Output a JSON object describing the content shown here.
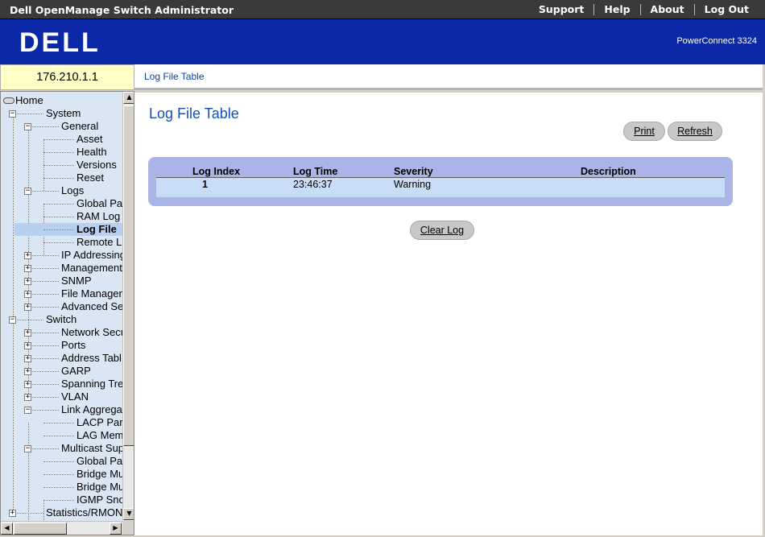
{
  "topbar": {
    "title": "Dell OpenManage Switch Administrator",
    "links": [
      "Support",
      "Help",
      "About",
      "Log Out"
    ]
  },
  "banner": {
    "logo_text": "DELL",
    "model": "PowerConnect 3324"
  },
  "ip_address": "176.210.1.1",
  "breadcrumb": "Log File Table",
  "tree": [
    {
      "label": "Home",
      "level": 0,
      "toggle": "",
      "selected": false
    },
    {
      "label": "System",
      "level": 1,
      "toggle": "-",
      "selected": false
    },
    {
      "label": "General",
      "level": 2,
      "toggle": "-",
      "selected": false
    },
    {
      "label": "Asset",
      "level": 3,
      "toggle": "",
      "selected": false
    },
    {
      "label": "Health",
      "level": 3,
      "toggle": "",
      "selected": false
    },
    {
      "label": "Versions",
      "level": 3,
      "toggle": "",
      "selected": false
    },
    {
      "label": "Reset",
      "level": 3,
      "toggle": "",
      "selected": false
    },
    {
      "label": "Logs",
      "level": 2,
      "toggle": "-",
      "selected": false
    },
    {
      "label": "Global Pa",
      "level": 3,
      "toggle": "",
      "selected": false
    },
    {
      "label": "RAM Log",
      "level": 3,
      "toggle": "",
      "selected": false
    },
    {
      "label": "Log File",
      "level": 3,
      "toggle": "",
      "selected": true
    },
    {
      "label": "Remote Lo",
      "level": 3,
      "toggle": "",
      "selected": false
    },
    {
      "label": "IP Addressing",
      "level": 2,
      "toggle": "+",
      "selected": false
    },
    {
      "label": "Management",
      "level": 2,
      "toggle": "+",
      "selected": false
    },
    {
      "label": "SNMP",
      "level": 2,
      "toggle": "+",
      "selected": false
    },
    {
      "label": "File Managen",
      "level": 2,
      "toggle": "+",
      "selected": false
    },
    {
      "label": "Advanced Se",
      "level": 2,
      "toggle": "+",
      "selected": false
    },
    {
      "label": "Switch",
      "level": 1,
      "toggle": "-",
      "selected": false
    },
    {
      "label": "Network Secu",
      "level": 2,
      "toggle": "+",
      "selected": false
    },
    {
      "label": "Ports",
      "level": 2,
      "toggle": "+",
      "selected": false
    },
    {
      "label": "Address Tabl",
      "level": 2,
      "toggle": "+",
      "selected": false
    },
    {
      "label": "GARP",
      "level": 2,
      "toggle": "+",
      "selected": false
    },
    {
      "label": "Spanning Tre",
      "level": 2,
      "toggle": "+",
      "selected": false
    },
    {
      "label": "VLAN",
      "level": 2,
      "toggle": "+",
      "selected": false
    },
    {
      "label": "Link Aggrega",
      "level": 2,
      "toggle": "-",
      "selected": false
    },
    {
      "label": "LACP Par",
      "level": 3,
      "toggle": "",
      "selected": false
    },
    {
      "label": "LAG Mem",
      "level": 3,
      "toggle": "",
      "selected": false
    },
    {
      "label": "Multicast Sup",
      "level": 2,
      "toggle": "-",
      "selected": false
    },
    {
      "label": "Global Pa",
      "level": 3,
      "toggle": "",
      "selected": false
    },
    {
      "label": "Bridge Mu",
      "level": 3,
      "toggle": "",
      "selected": false
    },
    {
      "label": "Bridge Mu",
      "level": 3,
      "toggle": "",
      "selected": false
    },
    {
      "label": "IGMP Sno",
      "level": 3,
      "toggle": "",
      "selected": false
    },
    {
      "label": "Statistics/RMON",
      "level": 1,
      "toggle": "+",
      "selected": false
    }
  ],
  "main": {
    "title": "Log File Table",
    "print_label": "Print",
    "refresh_label": "Refresh",
    "clear_label": "Clear Log",
    "columns": [
      "Log Index",
      "Log Time",
      "Severity",
      "Description"
    ],
    "rows": [
      {
        "index": "1",
        "time": "23:46:37",
        "severity": "Warning",
        "description": ""
      }
    ]
  }
}
